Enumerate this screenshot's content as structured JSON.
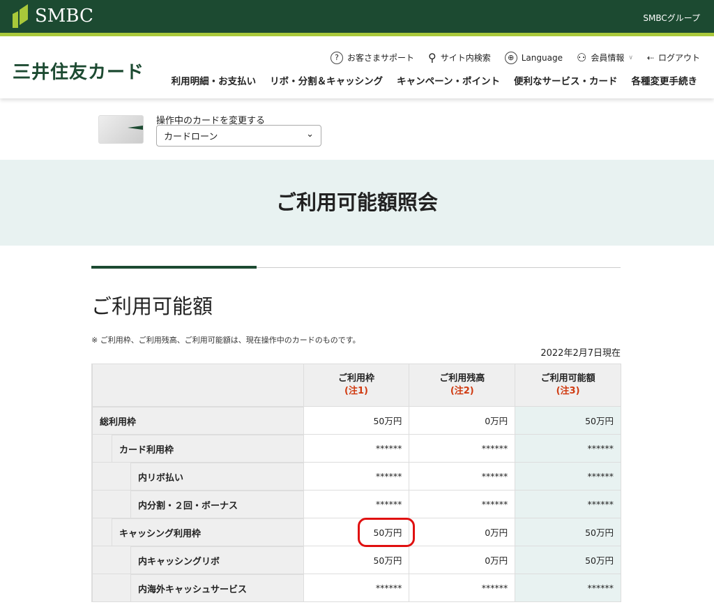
{
  "topbar": {
    "logo": "SMBC",
    "group_link": "SMBCグループ"
  },
  "header": {
    "brand": "三井住友カード",
    "utility": [
      {
        "icon": "question-circle-icon",
        "label": "お客さまサポート"
      },
      {
        "icon": "search-icon",
        "label": "サイト内検索"
      },
      {
        "icon": "globe-icon",
        "label": "Language"
      },
      {
        "icon": "user-icon",
        "label": "会員情報"
      },
      {
        "icon": "logout-icon",
        "label": "ログアウト"
      }
    ],
    "nav": [
      "利用明細・お支払い",
      "リボ・分割＆キャッシング",
      "キャンペーン・ポイント",
      "便利なサービス・カード",
      "各種変更手続き"
    ]
  },
  "card_selector": {
    "label": "操作中のカードを変更する",
    "selected": "カードローン"
  },
  "page_title": "ご利用可能額照会",
  "section_title": "ご利用可能額",
  "note": "※ ご利用枠、ご利用残高、ご利用可能額は、現在操作中のカードのものです。",
  "as_of": "2022年2月7日現在",
  "table": {
    "headers": [
      {
        "label": "ご利用枠",
        "note": "(注1)"
      },
      {
        "label": "ご利用残高",
        "note": "(注2)"
      },
      {
        "label": "ご利用可能額",
        "note": "(注3)"
      }
    ],
    "rows": [
      {
        "label": "総利用枠",
        "values": [
          "50万円",
          "0万円",
          "50万円"
        ]
      },
      {
        "label": "カード利用枠",
        "values": [
          "******",
          "******",
          "******"
        ]
      },
      {
        "label": "内リボ払い",
        "values": [
          "******",
          "******",
          "******"
        ]
      },
      {
        "label": "内分割・２回・ボーナス",
        "values": [
          "******",
          "******",
          "******"
        ]
      },
      {
        "label": "キャッシング利用枠",
        "values": [
          "50万円",
          "0万円",
          "50万円"
        ]
      },
      {
        "label": "内キャッシングリボ",
        "values": [
          "50万円",
          "0万円",
          "50万円"
        ]
      },
      {
        "label": "内海外キャッシュサービス",
        "values": [
          "******",
          "******",
          "******"
        ]
      }
    ]
  }
}
